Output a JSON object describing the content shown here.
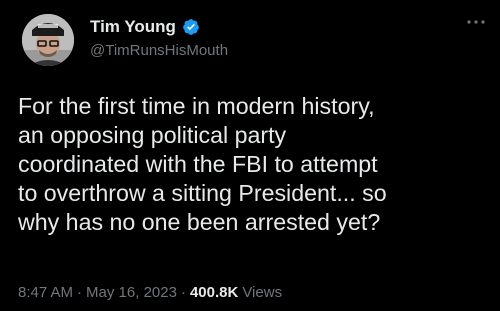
{
  "author": {
    "display_name": "Tim Young",
    "handle": "@TimRunsHisMouth",
    "verified_icon": "verified-badge-icon",
    "avatar_icon": "avatar-photo"
  },
  "tweet": {
    "lines": [
      "For the first time in modern history,",
      "an opposing political party",
      "coordinated with the FBI to attempt",
      "to overthrow a sitting President...  so",
      "why has no one been arrested yet?"
    ]
  },
  "meta": {
    "time": "8:47 AM",
    "separator": "·",
    "date": "May 16, 2023",
    "views_count": "400.8K",
    "views_label": "Views"
  },
  "controls": {
    "more_icon": "more-dots-icon"
  },
  "colors": {
    "background": "#000000",
    "text_primary": "#e7e9ea",
    "text_secondary": "#71767b",
    "verified_blue": "#1d9bf0"
  }
}
